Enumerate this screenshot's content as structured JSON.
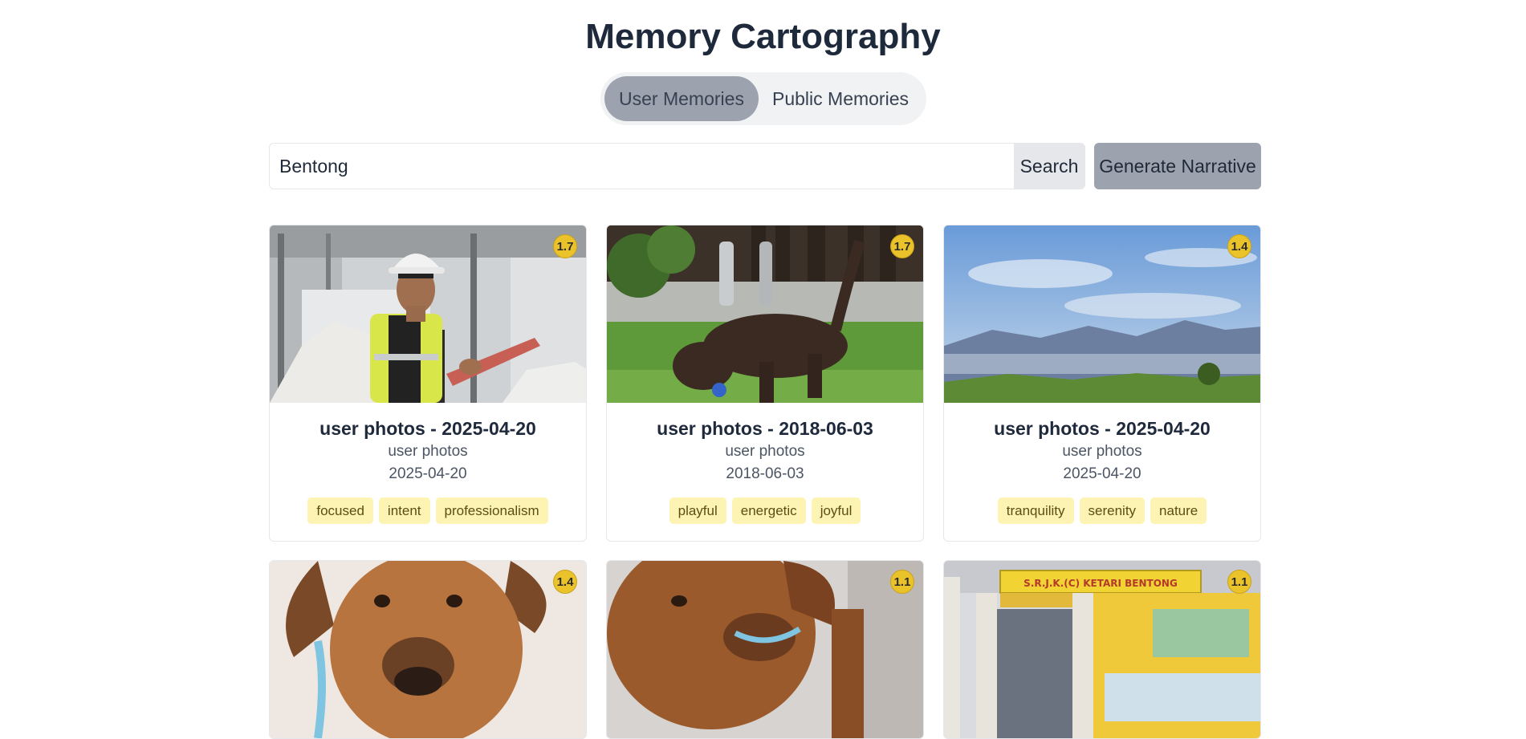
{
  "page": {
    "title": "Memory Cartography"
  },
  "tabs": {
    "user": "User Memories",
    "public": "Public Memories",
    "active": "user"
  },
  "search": {
    "value": "Bentong",
    "button": "Search"
  },
  "narrative_button": "Generate Narrative",
  "cards": [
    {
      "title": "user photos - 2025-04-20",
      "source": "user photos",
      "date": "2025-04-20",
      "score": "1.7",
      "tags": [
        "focused",
        "intent",
        "professionalism"
      ]
    },
    {
      "title": "user photos - 2018-06-03",
      "source": "user photos",
      "date": "2018-06-03",
      "score": "1.7",
      "tags": [
        "playful",
        "energetic",
        "joyful"
      ]
    },
    {
      "title": "user photos - 2025-04-20",
      "source": "user photos",
      "date": "2025-04-20",
      "score": "1.4",
      "tags": [
        "tranquility",
        "serenity",
        "nature"
      ]
    },
    {
      "score": "1.4"
    },
    {
      "score": "1.1"
    },
    {
      "score": "1.1"
    }
  ],
  "images": {
    "sign_line_1": "S.R.J.K.(C) KETARI BENTONG"
  }
}
